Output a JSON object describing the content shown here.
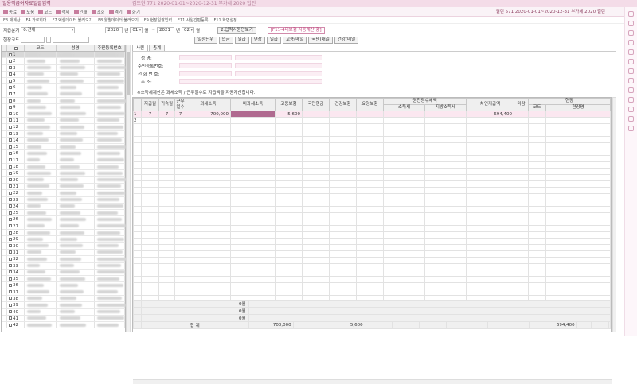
{
  "window": {
    "title": "일용직급여자료일괄입력",
    "info": "김도현 771 2020-01-01~2020-12-31 부가세 2020 법인"
  },
  "toolbar": {
    "buttons": [
      {
        "label": "종료",
        "icon": "close-icon"
      },
      {
        "label": "도움",
        "icon": "help-icon"
      },
      {
        "label": "코드",
        "icon": "code-icon"
      },
      {
        "label": "삭제",
        "icon": "delete-icon"
      },
      {
        "label": "인쇄",
        "icon": "print-icon"
      },
      {
        "label": "조회",
        "icon": "search-icon"
      },
      {
        "label": "엑기",
        "icon": "excel-icon"
      },
      {
        "label": "화기",
        "icon": "screen-icon"
      }
    ],
    "right_info": "결린 571 2020-01-01~2020-12-31 부가세 2020 결린"
  },
  "function_keys": [
    "F3 재계산",
    "F4 가로회대",
    "F7 엑셀데이터 불러오기",
    "F8 월별데이터 불러오기",
    "F9 현장일괄입력",
    "F11 사원간편등록",
    "F11 화면설정"
  ],
  "filter": {
    "pay_period_label": "지급분기",
    "pay_period_value": "0.전체",
    "from_year": "2020",
    "from_year_suffix": "년",
    "from_month": "01",
    "from_month_suffix": "월",
    "to_year": "2021",
    "to_year_suffix": "년",
    "to_month": "02",
    "to_month_suffix": "월",
    "site_code_label": "현장코드",
    "load_button": "2.입력사원만보기",
    "auto_calc_button": "[F11-4대보험 자동계산 함]",
    "tab_buttons": [
      "일정단위",
      "입금",
      "일급",
      "연장",
      "일급",
      "고용(매일",
      "국민(매일",
      "건강(매일"
    ]
  },
  "left_grid": {
    "headers": [
      "",
      "코드",
      "성명",
      "주민등록번호"
    ],
    "rows": [
      "1",
      "2",
      "3",
      "4",
      "5",
      "6",
      "7",
      "8",
      "9",
      "10",
      "11",
      "12",
      "13",
      "14",
      "15",
      "16",
      "17",
      "18",
      "19",
      "20",
      "21",
      "22",
      "23",
      "24",
      "25",
      "26",
      "27",
      "28",
      "29",
      "30",
      "31",
      "32",
      "33",
      "34",
      "35",
      "36",
      "37",
      "38",
      "39",
      "40",
      "41",
      "42"
    ]
  },
  "right_tabs": [
    "사원",
    "총계"
  ],
  "info_panel": {
    "labels": [
      "성 명:",
      "주민등록번호:",
      "전 화 번 호:",
      "주 소:"
    ],
    "note": "※소득세계산은 과세소득 / 근무일수로 지급액을 자동계산합니다."
  },
  "main_grid": {
    "headers": [
      "",
      "지급월",
      "귀속월",
      "근무일수",
      "과세소득",
      "비과세소득",
      "고용보험",
      "국민연금",
      "건강보험",
      "요양보험",
      "소득세",
      "지방소득세",
      "차인지급액",
      "마감",
      "코드",
      "현장명"
    ],
    "group_header_tax": "원천징수세액",
    "group_header_site": "현장",
    "rows": [
      {
        "no": "1",
        "pay_month": "7",
        "belong_month": "7",
        "days": "7",
        "taxable": "700,000",
        "employment": "5,600",
        "net": "694,400"
      },
      {
        "no": "2"
      }
    ],
    "summary_labels": [
      "0월",
      "0월",
      "0월"
    ],
    "total_label": "합  계",
    "total_taxable": "700,000",
    "total_employment": "5,600",
    "total_net": "694,400"
  }
}
